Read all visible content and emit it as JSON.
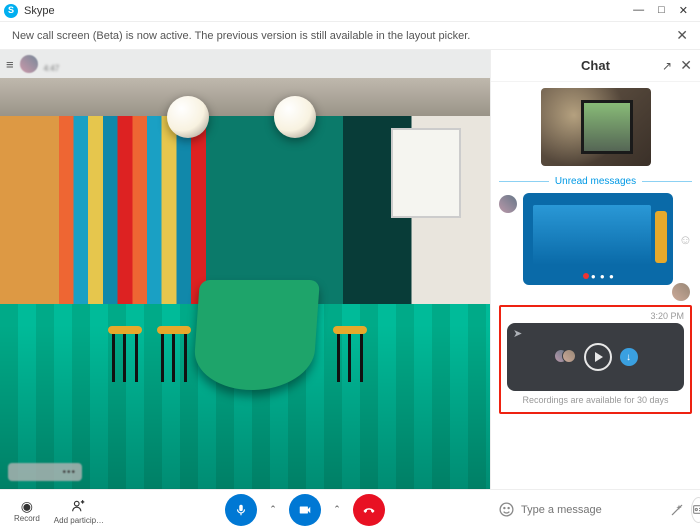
{
  "window": {
    "title": "Skype",
    "minimize": "—",
    "maximize": "□",
    "close": "✕"
  },
  "banner": {
    "text": "New call screen (Beta) is now active. The previous version is still available in the layout picker.",
    "close": "✕"
  },
  "call": {
    "menu": "≡",
    "duration": "4:47",
    "self_more": "•••"
  },
  "chat": {
    "title": "Chat",
    "expand": "↗",
    "close": "✕",
    "unread_label": "Unread messages",
    "reaction": "☺",
    "share_controls": "● ● ●",
    "recording": {
      "time": "3:20 PM",
      "forward_icon": "➤",
      "download_icon": "↓",
      "note": "Recordings are available for 30 days"
    }
  },
  "bottom": {
    "record_label": "Record",
    "add_label": "Add particip…",
    "chevron": "⌃",
    "message_placeholder": "Type a message",
    "more": "•••"
  }
}
